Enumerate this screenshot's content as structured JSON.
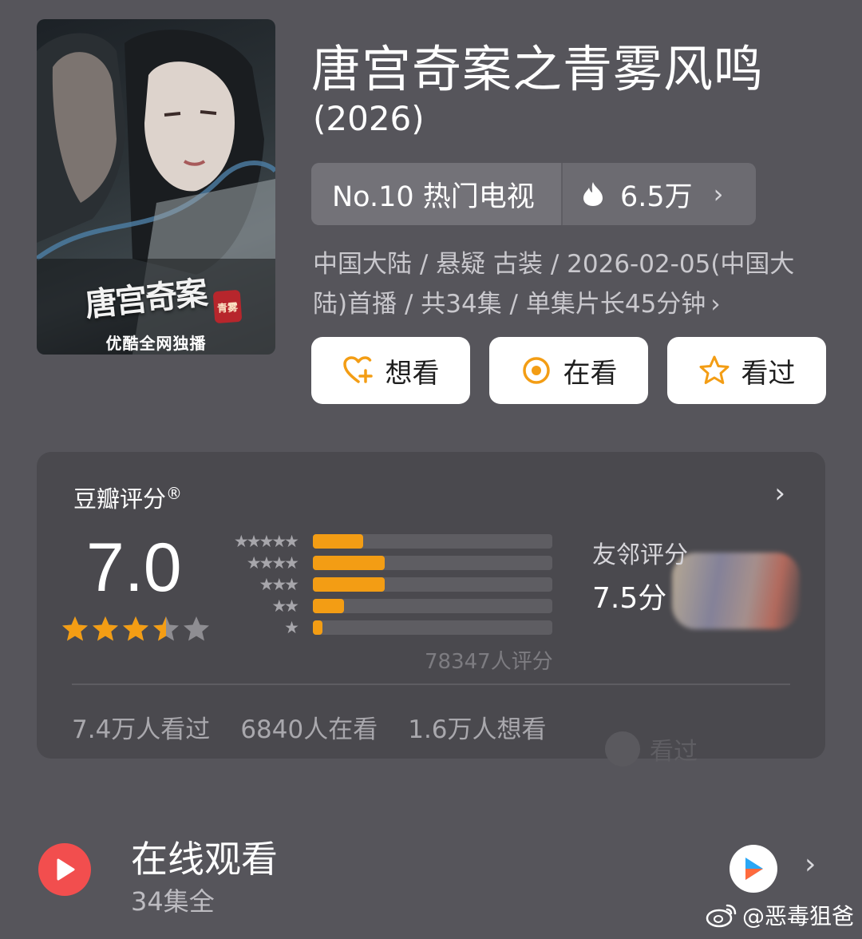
{
  "poster": {
    "title_art": "唐宫奇案",
    "seal": "青雾",
    "caption": "优酷全网独播"
  },
  "title": "唐宫奇案之青雾风鸣",
  "year": "(2026)",
  "rank": {
    "label": "No.10 热门电视",
    "heat": "6.5万",
    "chevron": "›"
  },
  "meta": {
    "line": "中国大陆 / 悬疑 古装 / 2026-02-05(中国大陆)首播 / 共34集 / 单集片长45分钟",
    "chevron": "›"
  },
  "actions": [
    {
      "label": "想看",
      "icon": "heart-plus-icon"
    },
    {
      "label": "在看",
      "icon": "target-icon"
    },
    {
      "label": "看过",
      "icon": "star-outline-icon"
    }
  ],
  "rating": {
    "title": "豆瓣评分",
    "registered": "®",
    "chevron": "›",
    "score": "7.0",
    "stars": 3.5,
    "distribution": [
      {
        "stars": "★★★★★",
        "fraction": 0.21
      },
      {
        "stars": "★★★★",
        "fraction": 0.3
      },
      {
        "stars": "★★★",
        "fraction": 0.3
      },
      {
        "stars": "★★",
        "fraction": 0.13
      },
      {
        "stars": "★",
        "fraction": 0.04
      }
    ],
    "raters": "78347人评分",
    "friend_label": "友邻评分",
    "friend_score": "7.5分",
    "counts": [
      "7.4万人看过",
      "6840人在看",
      "1.6万人想看"
    ],
    "ghost_text": "看过"
  },
  "watch": {
    "title": "在线观看",
    "subtitle": "34集全",
    "chevron": "›"
  },
  "watermark": "@恶毒狙爸",
  "colors": {
    "background": "#56555b",
    "accent_orange": "#f39d14",
    "play_red": "#f24e4e"
  }
}
